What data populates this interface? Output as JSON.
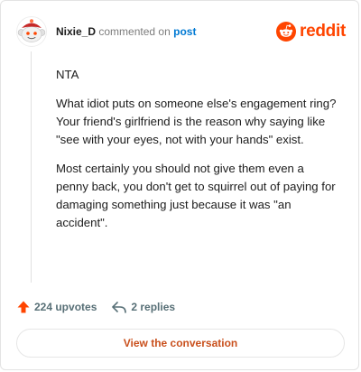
{
  "header": {
    "author": "Nixie_D",
    "action_text": "commented on",
    "post_link": "post",
    "brand": "reddit"
  },
  "comment": {
    "paragraphs": [
      "NTA",
      "What idiot puts on someone else's engagement ring? Your friend's girlfriend is the reason why saying like \"see with your eyes, not with your hands\" exist.",
      "Most certainly you should not give them even a penny back, you don't get to squirrel out of paying for damaging something just because it was \"an accident\"."
    ]
  },
  "actions": {
    "upvotes": "224 upvotes",
    "replies": "2 replies"
  },
  "cta": {
    "label": "View the conversation"
  },
  "colors": {
    "brand": "#ff4500",
    "link": "#0079d3",
    "cta_text": "#c9501d",
    "muted": "#7c7c7c"
  },
  "icons": {
    "avatar": "snoo-avatar",
    "brand": "reddit-logo-icon",
    "upvote": "upvote-arrow-icon",
    "reply": "reply-arrow-icon"
  }
}
